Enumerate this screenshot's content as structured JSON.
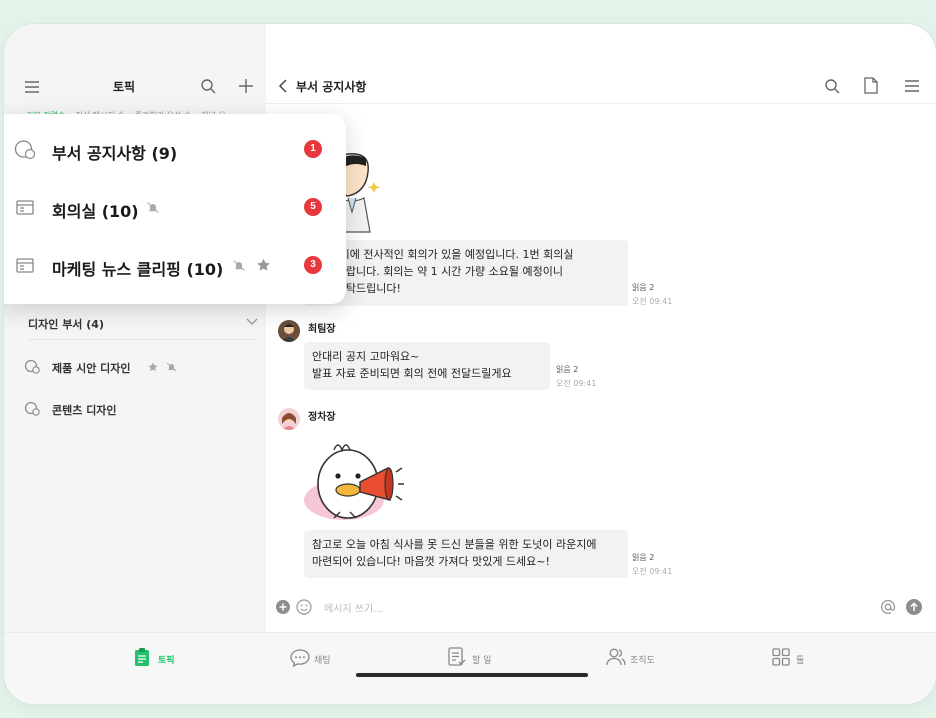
{
  "sidebar": {
    "title": "토픽",
    "filters": [
      "기본 정렬순",
      "최신 메시지 순",
      "즐겨찾기 우선 순",
      "채널 유"
    ],
    "popover_items": [
      {
        "label": "부서 공지사항 (9)",
        "badge": "1",
        "icon": "chat-bubble-icon"
      },
      {
        "label": "회의실 (10)",
        "badge": "5",
        "icon": "board-icon",
        "muted": true
      },
      {
        "label": "마케팅 뉴스 클리핑 (10)",
        "badge": "3",
        "icon": "board-icon",
        "muted": true,
        "starred": true
      }
    ],
    "group": {
      "label": "디자인 부서 (4)"
    },
    "items": [
      {
        "label": "제품 시안 디자인",
        "starred": true,
        "muted": true
      },
      {
        "label": "콘텐츠 디자인"
      }
    ]
  },
  "chat": {
    "title": "부서 공지사항",
    "messages": [
      {
        "lines": [
          "전 11시에 전사적인 회의가 있을 예정입니다. 1번 회의실",
          "시길 바랍니다. 회의는 약 1 시간 가량 소요될 예정이니",
          "참고 부탁드립니다!"
        ],
        "read": "읽음 2",
        "time": "오전 09:41"
      },
      {
        "sender": "최팀장",
        "lines": [
          "안대리 공지 고마워요~",
          "발표 자료 준비되면 회의 전에 전달드릴게요"
        ],
        "read": "읽음 2",
        "time": "오전 09:41"
      },
      {
        "sender": "정차장",
        "lines": [
          "참고로 오늘 아침 식사를 못 드신 분들을 위한 도넛이 라운지에",
          "마련되어 있습니다! 마음껏 가져다 맛있게 드세요~!"
        ],
        "read": "읽음 2",
        "time": "오전 09:41"
      }
    ],
    "composer_placeholder": "메시지 쓰기..."
  },
  "tabbar": {
    "tabs": [
      {
        "label": "토픽",
        "icon": "clipboard-icon",
        "active": true
      },
      {
        "label": "채팅",
        "icon": "chat-icon"
      },
      {
        "label": "할 일",
        "icon": "todo-icon"
      },
      {
        "label": "조직도",
        "icon": "people-icon"
      },
      {
        "label": "툴",
        "icon": "grid-icon"
      }
    ]
  },
  "colors": {
    "accent": "#23c16b",
    "badge": "#e8383d"
  }
}
